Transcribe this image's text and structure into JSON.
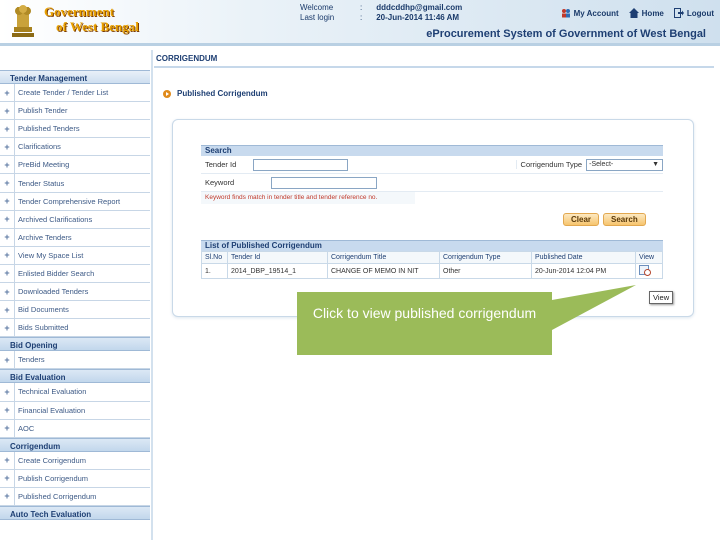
{
  "header": {
    "logo_line1": "Government",
    "logo_line2": "of West Bengal",
    "welcome_label": "Welcome",
    "welcome_value": "dddcddhp@gmail.com",
    "last_login_label": "Last login",
    "last_login_value": "20-Jun-2014 11:46 AM",
    "links": {
      "my_account": "My Account",
      "home": "Home",
      "logout": "Logout"
    },
    "system_title": "eProcurement System of Government of West Bengal"
  },
  "breadcrumb": "CORRIGENDUM",
  "sidebar": {
    "sections": [
      {
        "title": "Tender Management",
        "items": [
          "Create Tender / Tender List",
          "Publish Tender",
          "Published Tenders",
          "Clarifications",
          "PreBid Meeting",
          "Tender Status",
          "Tender Comprehensive Report",
          "Archived Clarifications",
          "Archive Tenders",
          "View My Space List",
          "Enlisted Bidder Search",
          "Downloaded Tenders",
          "Bid Documents",
          "Bids Submitted"
        ]
      },
      {
        "title": "Bid Opening",
        "items": [
          "Tenders"
        ]
      },
      {
        "title": "Bid Evaluation",
        "items": [
          "Technical Evaluation",
          "Financial Evaluation",
          "AOC"
        ]
      },
      {
        "title": "Corrigendum",
        "items": [
          "Create Corrigendum",
          "Publish Corrigendum",
          "Published Corrigendum"
        ]
      },
      {
        "title": "Auto Tech Evaluation",
        "items": []
      }
    ]
  },
  "page": {
    "heading": "Published Corrigendum",
    "search": {
      "title": "Search",
      "tender_id_label": "Tender Id",
      "tender_id_value": "",
      "corrigendum_type_label": "Corrigendum Type",
      "corrigendum_type_value": "-Select-",
      "keyword_label": "Keyword",
      "keyword_value": "",
      "hint": "Keyword finds match in tender title and tender reference no.",
      "clear_label": "Clear",
      "search_label": "Search"
    },
    "list": {
      "title": "List of Published Corrigendum",
      "columns": [
        "Sl.No",
        "Tender Id",
        "Corrigendum Title",
        "Corrigendum Type",
        "Published Date",
        "View"
      ],
      "rows": [
        [
          "1.",
          "2014_DBP_19514_1",
          "CHANGE OF MEMO IN NIT",
          "Other",
          "20-Jun-2014 12:04 PM",
          ""
        ]
      ]
    },
    "tooltip": "View",
    "callout": "Click to view published corrigendum"
  },
  "colors": {
    "callout": "#9bbb59",
    "nav_text": "#1e3f73",
    "button": "#f6c46d"
  }
}
